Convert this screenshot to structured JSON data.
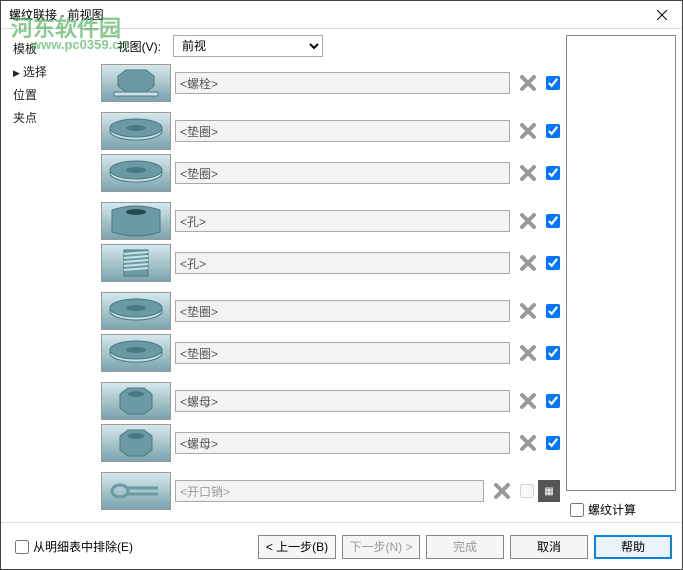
{
  "window": {
    "title": "螺纹联接 - 前视图"
  },
  "watermark": {
    "text": "河东软件园",
    "url": "www.pc0359.cn"
  },
  "sidebar": {
    "items": [
      "模板",
      "选择",
      "位置",
      "夹点"
    ],
    "active_index": 1
  },
  "view": {
    "label": "视图(V):",
    "value": "前视"
  },
  "parts": [
    {
      "label": "<螺栓>",
      "icon": "bolt",
      "enabled": true,
      "checked": true
    },
    {
      "label": "<垫圈>",
      "icon": "washer",
      "enabled": true,
      "checked": true,
      "gap": true
    },
    {
      "label": "<垫圈>",
      "icon": "washer",
      "enabled": true,
      "checked": true
    },
    {
      "label": "<孔>",
      "icon": "hole",
      "enabled": true,
      "checked": true,
      "gap": true
    },
    {
      "label": "<孔>",
      "icon": "thread",
      "enabled": true,
      "checked": true
    },
    {
      "label": "<垫圈>",
      "icon": "washer",
      "enabled": true,
      "checked": true,
      "gap": true
    },
    {
      "label": "<垫圈>",
      "icon": "washer",
      "enabled": true,
      "checked": true
    },
    {
      "label": "<螺母>",
      "icon": "nut",
      "enabled": true,
      "checked": true,
      "gap": true
    },
    {
      "label": "<螺母>",
      "icon": "nut",
      "enabled": true,
      "checked": true
    },
    {
      "label": "<开口销>",
      "icon": "pin",
      "enabled": false,
      "checked": false,
      "gap": true,
      "calc": true
    }
  ],
  "thread_calc": {
    "label": "螺纹计算",
    "checked": false
  },
  "footer": {
    "exclude_label": "从明细表中排除(E)",
    "back": "< 上一步(B)",
    "next": "下一步(N) >",
    "finish": "完成",
    "cancel": "取消",
    "help": "帮助"
  }
}
